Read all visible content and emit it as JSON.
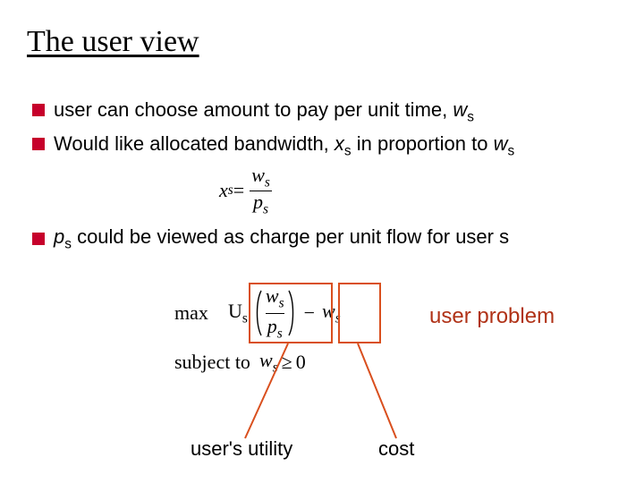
{
  "title": "The user view",
  "bullets": {
    "b1_pre": "user can choose amount to pay per unit time, ",
    "b1_var": "w",
    "b1_sub": "s",
    "b2_pre": "Would like allocated bandwidth, ",
    "b2_var1": "x",
    "b2_sub1": "s",
    "b2_mid": " in proportion to ",
    "b2_var2": "w",
    "b2_sub2": "s"
  },
  "eq1": {
    "lhs_var": "x",
    "lhs_sub": "s",
    "eq": " = ",
    "num_var": "w",
    "num_sub": "s",
    "den_var": "p",
    "den_sub": "s"
  },
  "bullet3": {
    "var": "p",
    "sub": "s",
    "text": " could be viewed as charge per unit flow for user s"
  },
  "opt": {
    "max": "max",
    "U": "U",
    "Usub": "s",
    "frac_num_var": "w",
    "frac_num_sub": "s",
    "frac_den_var": "p",
    "frac_den_sub": "s",
    "minus": "−",
    "tail_var": "w",
    "tail_sub": "s",
    "subject": "subject to",
    "cons_var": "w",
    "cons_sub": "s",
    "ge": "≥",
    "zero": "0"
  },
  "labels": {
    "user_problem": "user problem",
    "utility": "user's utility",
    "cost": "cost"
  },
  "colors": {
    "bullet": "#c6002b",
    "box": "#d94f1e",
    "accent_text": "#b03217"
  }
}
